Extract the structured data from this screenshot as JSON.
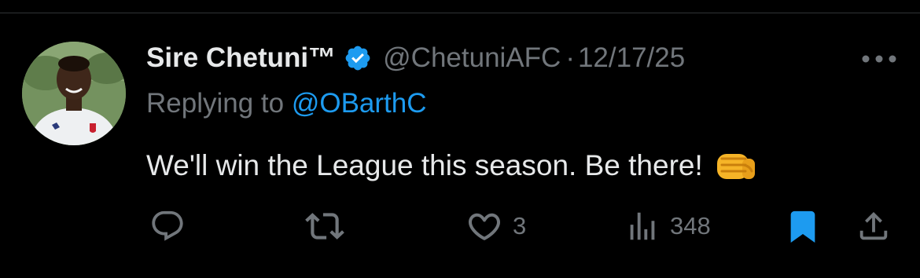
{
  "tweet": {
    "author": {
      "display_name": "Sire Chetuni™",
      "handle": "@ChetuniAFC",
      "verified": true,
      "avatar_icon": "profile-photo"
    },
    "separator": "·",
    "date": "12/17/25",
    "reply": {
      "prefix": "Replying to ",
      "handle": "@OBarthC"
    },
    "text": "We'll win the League this season. Be there!",
    "emoji": "👊"
  },
  "actions": {
    "reply": {
      "icon": "reply-icon",
      "count": ""
    },
    "retweet": {
      "icon": "retweet-icon",
      "count": ""
    },
    "like": {
      "icon": "heart-icon",
      "count": "3"
    },
    "views": {
      "icon": "views-icon",
      "count": "348"
    },
    "bookmark": {
      "icon": "bookmark-icon",
      "active": true
    },
    "share": {
      "icon": "share-icon"
    }
  },
  "colors": {
    "background": "#000000",
    "text": "#e7e9ea",
    "secondary": "#71767b",
    "accent": "#1d9bf0",
    "divider": "#2f3336"
  }
}
